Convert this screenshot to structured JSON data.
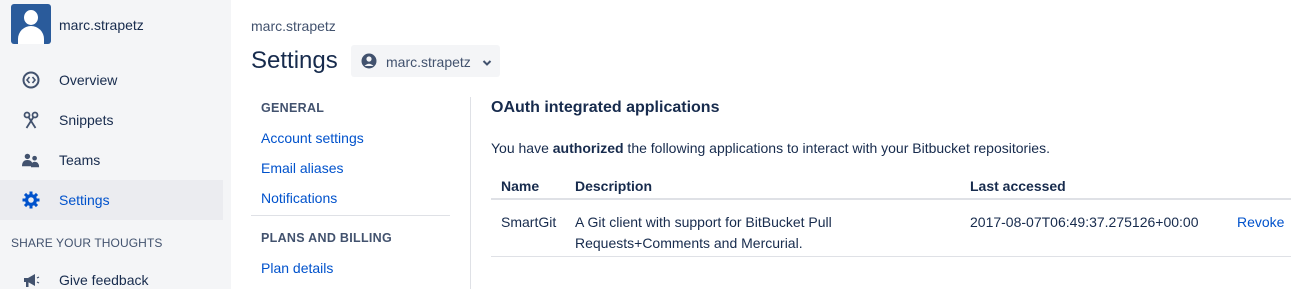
{
  "sidebar": {
    "user_name": "marc.strapetz",
    "items": [
      {
        "label": "Overview",
        "icon": "overview-icon"
      },
      {
        "label": "Snippets",
        "icon": "scissors-icon"
      },
      {
        "label": "Teams",
        "icon": "people-icon"
      },
      {
        "label": "Settings",
        "icon": "gear-icon"
      }
    ],
    "section_title": "SHARE YOUR THOUGHTS",
    "feedback_label": "Give feedback"
  },
  "header": {
    "breadcrumb": "marc.strapetz",
    "title": "Settings",
    "account_select": "marc.strapetz"
  },
  "settings_nav": {
    "general_heading": "GENERAL",
    "general_links": [
      "Account settings",
      "Email aliases",
      "Notifications"
    ],
    "billing_heading": "PLANS AND BILLING",
    "billing_links": [
      "Plan details"
    ]
  },
  "content": {
    "title": "OAuth integrated applications",
    "intro_pre": "You have ",
    "intro_bold": "authorized",
    "intro_post": " the following applications to interact with your Bitbucket repositories.",
    "columns": [
      "Name",
      "Description",
      "Last accessed"
    ],
    "rows": [
      {
        "name": "SmartGit",
        "description_line1": "A Git client with support for BitBucket Pull",
        "description_line2": "Requests+Comments and Mercurial.",
        "last_accessed": "2017-08-07T06:49:37.275126+00:00",
        "action": "Revoke"
      }
    ]
  },
  "colors": {
    "link": "#0052cc",
    "text": "#172b4d",
    "sidebar_bg": "#f4f5f7",
    "avatar": "#2a5b9b"
  }
}
